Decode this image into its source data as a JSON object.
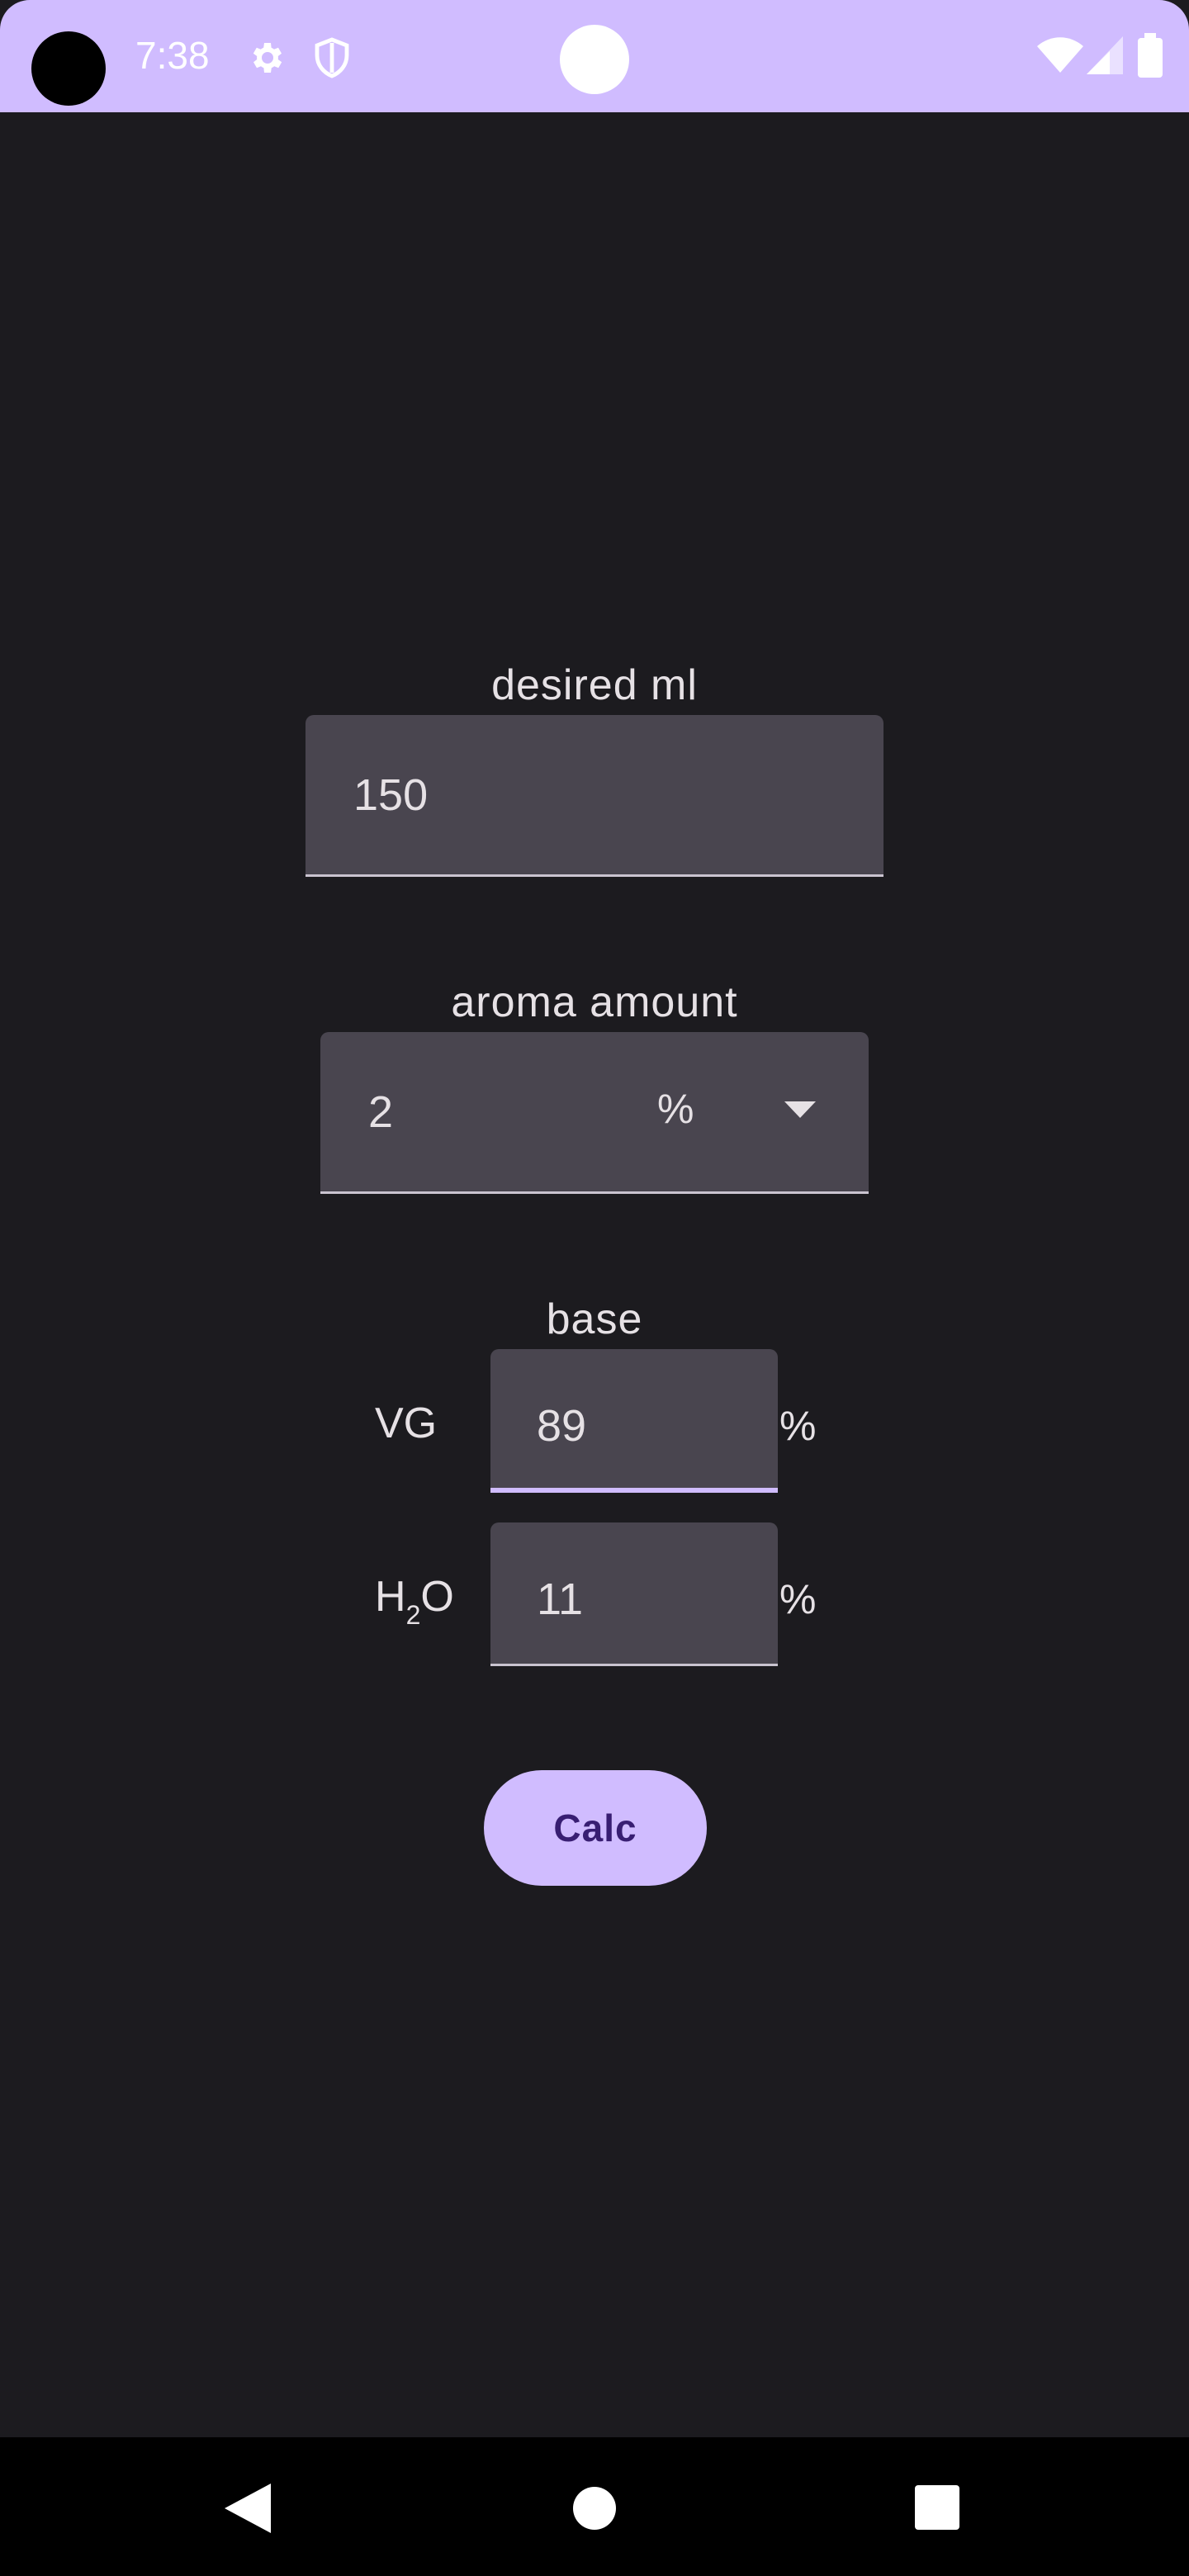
{
  "status_bar": {
    "time": "7:38",
    "icons": [
      "camera-hole",
      "settings-icon",
      "shield-icon",
      "wifi-icon",
      "signal-icon",
      "battery-icon"
    ],
    "background": "#d0bcff"
  },
  "form": {
    "desired_ml": {
      "label": "desired ml",
      "value": "150"
    },
    "aroma_amount": {
      "label": "aroma amount",
      "value": "2",
      "unit_selected": "%"
    },
    "base": {
      "label": "base",
      "vg": {
        "label": "VG",
        "value": "89",
        "unit": "%"
      },
      "h2o": {
        "label_main": "H",
        "label_sub": "2",
        "label_end": "O",
        "value": "11",
        "unit": "%"
      }
    },
    "calc_button": "Calc"
  },
  "nav_bar": {
    "icons": [
      "back-icon",
      "home-icon",
      "recents-icon"
    ]
  },
  "colors": {
    "background": "#1c1b1f",
    "field": "#49454f",
    "accent": "#d0bcff",
    "on_accent": "#381e72",
    "text": "#e6e1e5"
  }
}
